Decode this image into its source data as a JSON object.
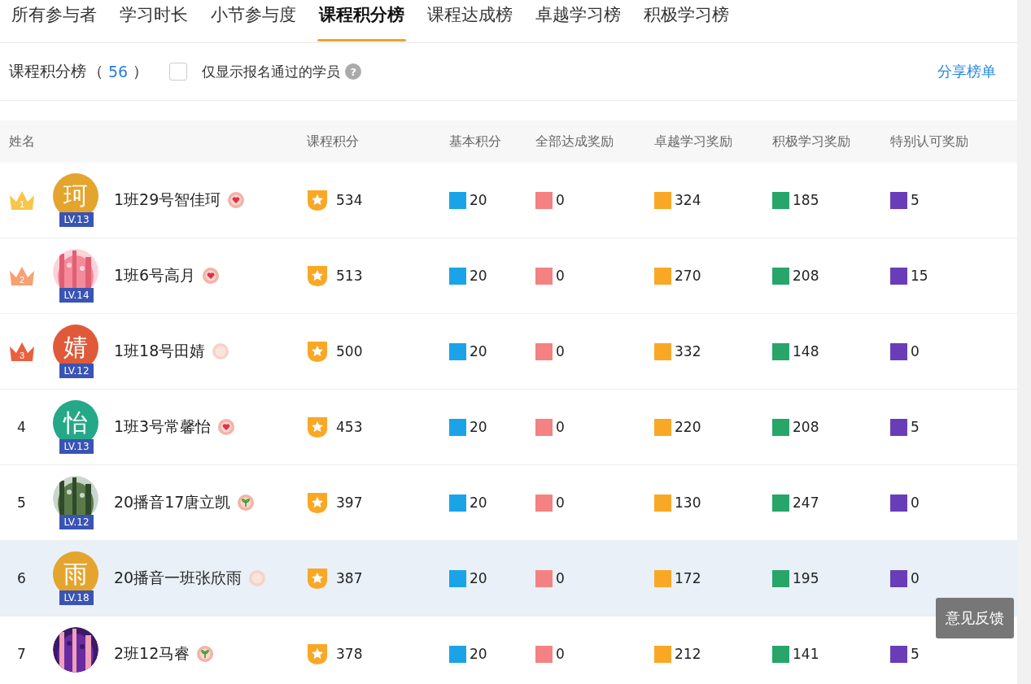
{
  "tabs": [
    {
      "label": "所有参与者",
      "selected": false
    },
    {
      "label": "学习时长",
      "selected": false
    },
    {
      "label": "小节参与度",
      "selected": false
    },
    {
      "label": "课程积分榜",
      "selected": true
    },
    {
      "label": "课程达成榜",
      "selected": false
    },
    {
      "label": "卓越学习榜",
      "selected": false
    },
    {
      "label": "积极学习榜",
      "selected": false
    }
  ],
  "toolbar": {
    "title": "课程积分榜",
    "count_open": "（",
    "count": "56",
    "count_close": "）",
    "filter": {
      "label": "仅显示报名通过的学员",
      "checked": false
    },
    "help": "?",
    "share": "分享榜单"
  },
  "columns": [
    {
      "label": "姓名"
    },
    {
      "label": "课程积分"
    },
    {
      "label": "基本积分",
      "color": "#1ba3e8"
    },
    {
      "label": "全部达成奖励",
      "color": "#f48282"
    },
    {
      "label": "卓越学习奖励",
      "color": "#f9a826"
    },
    {
      "label": "积极学习奖励",
      "color": "#28a569"
    },
    {
      "label": "特别认可奖励",
      "color": "#6a3db8"
    }
  ],
  "rows": [
    {
      "rank": {
        "kind": "crown",
        "text": "1",
        "color": "#f7c64a"
      },
      "avatar": {
        "kind": "letter",
        "text": "珂",
        "color": "#e4a52e"
      },
      "level": "LV.13",
      "name": "1班29号智佳珂",
      "badge": {
        "kind": "heart"
      },
      "highlighted": false,
      "points": "534",
      "scores": [
        "20",
        "0",
        "324",
        "185",
        "5"
      ]
    },
    {
      "rank": {
        "kind": "crown",
        "text": "2",
        "color": "#f6a173"
      },
      "level": "LV.14",
      "name": "1班6号高月",
      "badge": {
        "kind": "heart"
      },
      "highlighted": false,
      "points": "513",
      "scores": [
        "20",
        "0",
        "270",
        "208",
        "15"
      ]
    },
    {
      "rank": {
        "kind": "crown",
        "text": "3",
        "color": "#e9603f"
      },
      "avatar": {
        "kind": "letter",
        "text": "婧",
        "color": "#e05a3a"
      },
      "level": "LV.12",
      "name": "1班18号田婧",
      "badge": {
        "kind": "faded"
      },
      "highlighted": false,
      "points": "500",
      "scores": [
        "20",
        "0",
        "332",
        "148",
        "0"
      ]
    },
    {
      "rank": {
        "kind": "number",
        "text": "4"
      },
      "avatar": {
        "kind": "letter",
        "text": "怡",
        "color": "#24a888"
      },
      "level": "LV.13",
      "name": "1班3号常馨怡",
      "badge": {
        "kind": "heart"
      },
      "highlighted": false,
      "points": "453",
      "scores": [
        "20",
        "0",
        "220",
        "208",
        "5"
      ]
    },
    {
      "rank": {
        "kind": "number",
        "text": "5"
      },
      "level": "LV.12",
      "name": "20播音17唐立凯",
      "badge": {
        "kind": "sprout"
      },
      "highlighted": false,
      "points": "397",
      "scores": [
        "20",
        "0",
        "130",
        "247",
        "0"
      ]
    },
    {
      "rank": {
        "kind": "number",
        "text": "6"
      },
      "avatar": {
        "kind": "letter",
        "text": "雨",
        "color": "#e4a52e"
      },
      "level": "LV.18",
      "name": "20播音一班张欣雨",
      "badge": {
        "kind": "faded"
      },
      "highlighted": true,
      "points": "387",
      "scores": [
        "20",
        "0",
        "172",
        "195",
        "0"
      ]
    },
    {
      "rank": {
        "kind": "number",
        "text": "7"
      },
      "name": "2班12马睿",
      "badge": {
        "kind": "sprout"
      },
      "highlighted": false,
      "points": "378",
      "scores": [
        "20",
        "0",
        "212",
        "141",
        "5"
      ]
    }
  ],
  "feedback": "意见反馈"
}
